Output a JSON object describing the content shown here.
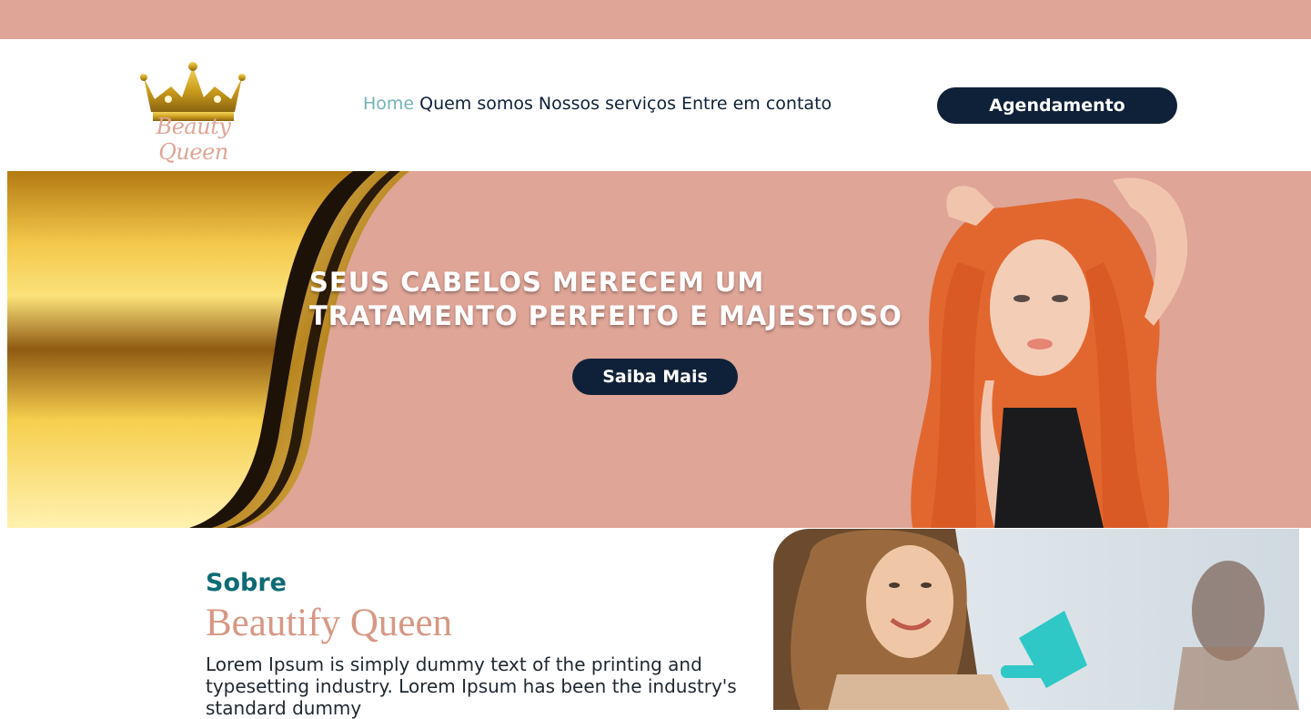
{
  "colors": {
    "accent": "#dfa597",
    "navy": "#0f2138",
    "teal": "#0e6b73",
    "nav_active": "#73b4b4"
  },
  "brand": {
    "logo_text": "Beauty Queen",
    "logo_icon": "crown-icon"
  },
  "nav": {
    "items": [
      {
        "label": "Home",
        "active": true
      },
      {
        "label": "Quem somos",
        "active": false
      },
      {
        "label": "Nossos serviços",
        "active": false
      },
      {
        "label": "Entre em contato",
        "active": false
      }
    ],
    "cta_label": "Agendamento"
  },
  "hero": {
    "title": "SEUS CABELOS MERECEM UM TRATAMENTO PERFEITO E MAJESTOSO",
    "button_label": "Saiba Mais"
  },
  "about": {
    "subtitle": "Sobre",
    "title": "Beautify Queen",
    "text": "Lorem Ipsum is simply dummy text of the printing and typesetting industry. Lorem Ipsum has been the industry's standard dummy"
  }
}
